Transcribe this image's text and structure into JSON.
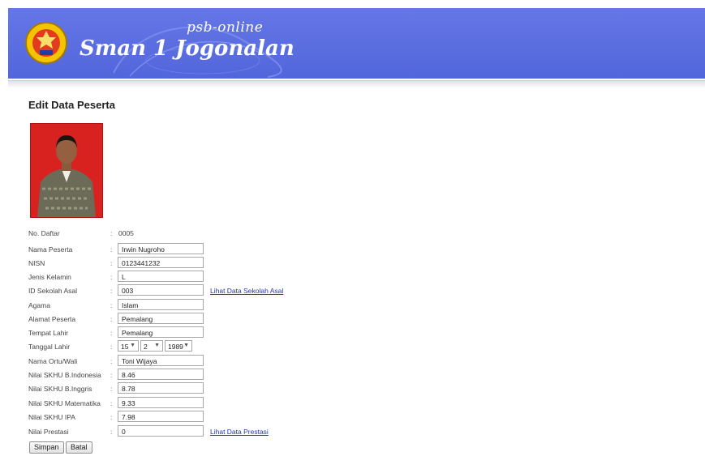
{
  "header": {
    "subtitle": "psb-online",
    "title": "Sman 1 Jogonalan"
  },
  "page": {
    "title": "Edit Data Peserta"
  },
  "form": {
    "no_daftar": {
      "label": "No. Daftar",
      "value": "0005"
    },
    "nama_peserta": {
      "label": "Nama Peserta",
      "value": "Irwin Nugroho"
    },
    "nisn": {
      "label": "NISN",
      "value": "0123441232"
    },
    "jenis_kelamin": {
      "label": "Jenis Kelamin",
      "value": "L"
    },
    "id_sekolah_asal": {
      "label": "ID Sekolah Asal",
      "value": "003",
      "link": "Lihat Data Sekolah Asal"
    },
    "agama": {
      "label": "Agama",
      "value": "Islam"
    },
    "alamat_peserta": {
      "label": "Alamat Peserta",
      "value": "Pemalang"
    },
    "tempat_lahir": {
      "label": "Tempat Lahir",
      "value": "Pemalang"
    },
    "tanggal_lahir": {
      "label": "Tanggal Lahir",
      "day": "15",
      "month": "2",
      "year": "1989"
    },
    "nama_ortu": {
      "label": "Nama Ortu/Wali",
      "value": "Toni Wijaya"
    },
    "skhu_indonesia": {
      "label": "Nilai SKHU B.Indonesia",
      "value": "8.46"
    },
    "skhu_inggris": {
      "label": "Nilai SKHU B.Inggris",
      "value": "8.78"
    },
    "skhu_matematika": {
      "label": "Nilai SKHU Matematika",
      "value": "9.33"
    },
    "skhu_ipa": {
      "label": "Nilai SKHU IPA",
      "value": "7.98"
    },
    "nilai_prestasi": {
      "label": "Nilai Prestasi",
      "value": "0",
      "link": "Lihat Data Prestasi"
    },
    "colon": ":"
  },
  "buttons": {
    "simpan": "Simpan",
    "batal": "Batal"
  },
  "colors": {
    "header_blue": "#5b6fe0",
    "link": "#2233bb",
    "photo_bg": "#d81f1c"
  }
}
